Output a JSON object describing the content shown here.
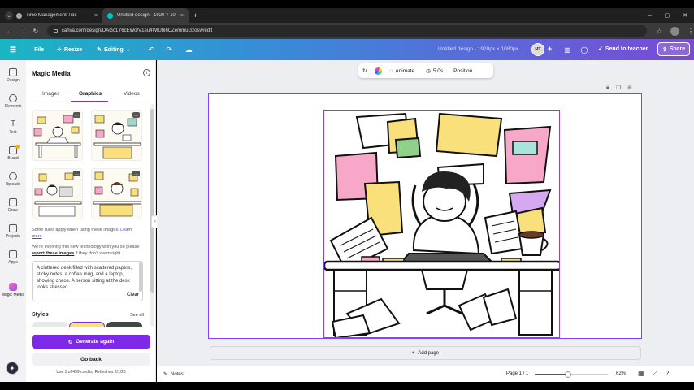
{
  "browser": {
    "tabs": [
      {
        "title": "Time Management Tips",
        "close": "×"
      },
      {
        "title": "Untitled design - 1920 × 1080px",
        "close": "×"
      }
    ],
    "new_tab": "+",
    "url": "canva.com/design/DAGc1Y6cEWo/V1eu4WlUhl6CZemmuGzosw/edit",
    "window_controls": [
      "–",
      "▢",
      "✕"
    ]
  },
  "toolbar": {
    "file": "File",
    "resize": "Resize",
    "editing": "Editing",
    "doc_title": "Untitled design - 1920px × 1080px",
    "avatar_initials": "MT",
    "send_to_teacher": "Send to teacher",
    "share": "Share"
  },
  "rail": {
    "items": [
      "Design",
      "Elements",
      "Text",
      "Brand",
      "Uploads",
      "Draw",
      "Projects",
      "Apps",
      "Magic Media"
    ]
  },
  "panel": {
    "title": "Magic Media",
    "tabs": [
      "Images",
      "Graphics",
      "Videos"
    ],
    "active_tab": "Graphics",
    "note1_text": "Some rules apply when using these images.",
    "note1_link": "Learn more",
    "note2_pre": "We're evolving this new technology with you so please",
    "note2_link": "report these images",
    "note2_post": "if they don't seem right.",
    "prompt": "A cluttered desk filled with scattered papers, sticky notes, a coffee mug, and a laptop, showing chaos. A person sitting at the desk looks stressed.",
    "clear": "Clear",
    "styles_label": "Styles",
    "see_all": "See all",
    "generate_again": "Generate again",
    "go_back": "Go back",
    "credits": "Use 1 of 499 credits. Refreshes 2/1/25"
  },
  "context_toolbar": {
    "animate": "Animate",
    "duration": "5.0s",
    "position": "Position"
  },
  "editor": {
    "add_page": "Add page"
  },
  "bottombar": {
    "notes": "Notes",
    "page": "Page 1 / 1",
    "zoom": "62%",
    "zoom_fraction": 0.45
  },
  "colors": {
    "accent": "#7d2ae8",
    "toolbar_start": "#1ab5c3",
    "toolbar_end": "#7a4ad6"
  }
}
